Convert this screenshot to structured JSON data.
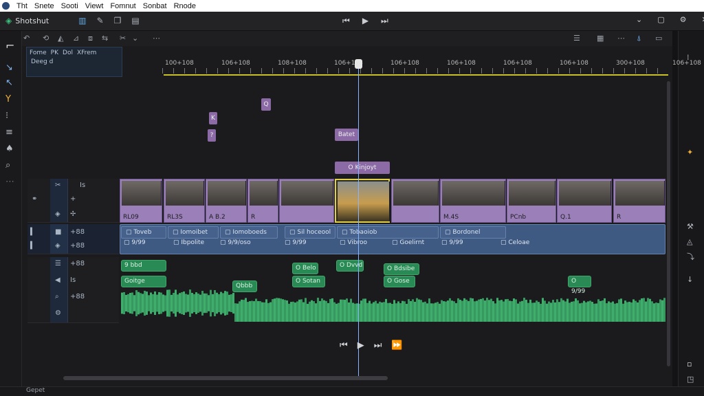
{
  "menubar": {
    "items": [
      "Tht",
      "Snete",
      "Sooti",
      "Viewt",
      "Fomnut",
      "Sonbat",
      "Rnode"
    ]
  },
  "app": {
    "title": "Shotshut"
  },
  "ruler": {
    "labels": [
      "100+108",
      "106+108",
      "108+108",
      "106+108",
      "106+108",
      "106+108",
      "106+108",
      "106+108",
      "300+108",
      "106+108"
    ]
  },
  "header": {
    "tabs": [
      "Fome",
      "PK",
      "Dol",
      "XFrem"
    ],
    "subtitle": "Deeg d"
  },
  "keyframes": [
    "Q",
    "K",
    "?",
    "Batet",
    "O Kinjoyt"
  ],
  "video_clips": [
    "RL09",
    "RL3S",
    "A B.2",
    "R",
    "R",
    "M.4S",
    "PCnb",
    "Q.1",
    "R"
  ],
  "audio_clips_row1": [
    "Toveb",
    "Iomoibet",
    "Iomoboeds",
    "Sil hoceool",
    "Tobaoiob",
    "Bordonel"
  ],
  "audio_clips_row2": [
    "9/99",
    "Ibpolite",
    "9/9/oso",
    "9/99",
    "Vibroo",
    "Goelirnt",
    "9/99",
    "Celoae"
  ],
  "green_clips": [
    "9 bbd",
    "Goitge",
    "Qbbb",
    "O Belo",
    "O Sotan",
    "O Dvvd",
    "O Bdsibe",
    "O Gose",
    "O 9/99"
  ],
  "track_labels": [
    "Is",
    "+88",
    "+88",
    "+88",
    "Is",
    "+88"
  ],
  "status": {
    "text": "Gepet"
  },
  "colors": {
    "video": "#9b7fb8",
    "audio": "#46628c",
    "green": "#2a8a55",
    "playhead": "#8ab4ff",
    "ruler_line": "#c9c02a"
  },
  "icons": [
    "play-icon",
    "skip-back-icon",
    "skip-forward-icon",
    "scissors-icon",
    "pointer-icon",
    "settings-icon"
  ]
}
